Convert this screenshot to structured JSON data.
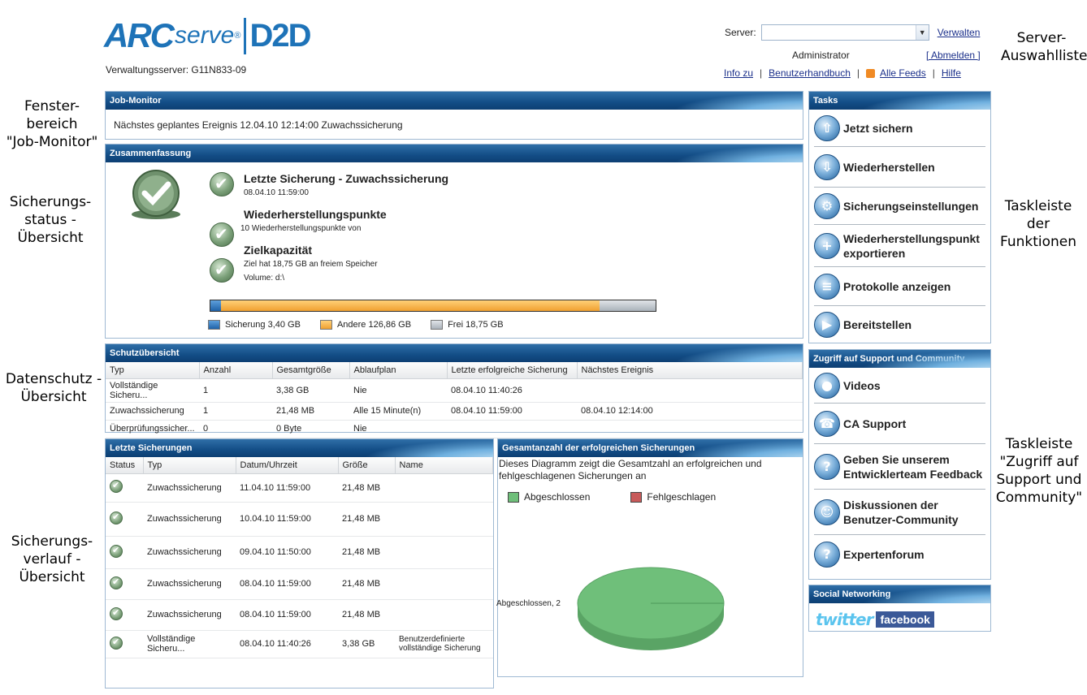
{
  "header": {
    "logo_arc": "ARC",
    "logo_serve": "serve",
    "logo_reg": "®",
    "logo_d2d": "D2D",
    "management_server": "Verwaltungsserver: G11N833-09",
    "server_label": "Server:",
    "server_value": "",
    "manage_link": "Verwalten",
    "user": "Administrator",
    "logout_link": "[ Abmelden ]",
    "links": {
      "info": "Info zu",
      "manual": "Benutzerhandbuch",
      "feeds": "Alle Feeds",
      "help": "Hilfe"
    }
  },
  "annotations": {
    "server_list": "Server-\nAuswahlliste",
    "job_monitor": "Fenster-\nbereich\n\"Job-Monitor\"",
    "backup_status": "Sicherungs-\nstatus -\nÜbersicht",
    "task_bar": "Taskleiste\nder\nFunktionen",
    "data_protection": "Datenschutz -\nÜbersicht",
    "support_bar": "Taskleiste\n\"Zugriff auf\nSupport und\nCommunity\"",
    "backup_history": "Sicherungs-\nverlauf -\nÜbersicht"
  },
  "job_monitor": {
    "title": "Job-Monitor",
    "text": "Nächstes geplantes Ereignis 12.04.10 12:14:00 Zuwachssicherung"
  },
  "summary": {
    "title": "Zusammenfassung",
    "last_backup_title": "Letzte Sicherung - Zuwachssicherung",
    "last_backup_time": "08.04.10 11:59:00",
    "recovery_title": "Wiederherstellungspunkte",
    "recovery_text": "10 Wiederherstellungspunkte von",
    "capacity_title": "Zielkapazität",
    "capacity_free": "Ziel hat 18,75 GB an freiem Speicher",
    "capacity_volume": "Volume: d:\\",
    "usage": {
      "backup_gb": 3.4,
      "other_gb": 126.86,
      "free_gb": 18.75
    },
    "legend": {
      "backup": "Sicherung 3,40 GB",
      "other": "Andere  126,86 GB",
      "free": "Frei  18,75 GB"
    },
    "colors": {
      "backup": "#1f62a8",
      "other": "#f0a030",
      "free": "#aab2ba"
    }
  },
  "protection": {
    "title": "Schutzübersicht",
    "columns": [
      "Typ",
      "Anzahl",
      "Gesamtgröße",
      "Ablaufplan",
      "Letzte erfolgreiche Sicherung",
      "Nächstes Ereignis"
    ],
    "rows": [
      [
        "Vollständige Sicheru...",
        "1",
        "3,38 GB",
        "Nie",
        "08.04.10 11:40:26",
        ""
      ],
      [
        "Zuwachssicherung",
        "1",
        "21,48 MB",
        "Alle 15 Minute(n)",
        "08.04.10 11:59:00",
        "08.04.10 12:14:00"
      ],
      [
        "Überprüfungssicher...",
        "0",
        "0 Byte",
        "Nie",
        "",
        ""
      ]
    ]
  },
  "recent": {
    "title": "Letzte Sicherungen",
    "columns": [
      "Status",
      "Typ",
      "Datum/Uhrzeit",
      "Größe",
      "Name"
    ],
    "rows": [
      [
        "",
        "Zuwachssicherung",
        "11.04.10 11:59:00",
        "21,48 MB",
        ""
      ],
      [
        "",
        "Zuwachssicherung",
        "10.04.10 11:59:00",
        "21,48 MB",
        ""
      ],
      [
        "",
        "Zuwachssicherung",
        "09.04.10 11:50:00",
        "21,48 MB",
        ""
      ],
      [
        "",
        "Zuwachssicherung",
        "08.04.10 11:59:00",
        "21,48 MB",
        ""
      ],
      [
        "",
        "Zuwachssicherung",
        "08.04.10 11:59:00",
        "21,48 MB",
        ""
      ],
      [
        "",
        "Vollständige Sicheru...",
        "08.04.10 11:40:26",
        "3,38 GB",
        "Benutzerdefinierte vollständige Sicherung"
      ]
    ]
  },
  "success_chart": {
    "title": "Gesamtanzahl der erfolgreichen Sicherungen",
    "description": "Dieses Diagramm zeigt die Gesamtzahl an erfolgreichen und fehlgeschlagenen Sicherungen an",
    "legend_ok": "Abgeschlossen",
    "legend_fail": "Fehlgeschlagen",
    "slice_label": "Abgeschlossen, 2",
    "color_ok": "#6fbf7a",
    "color_fail": "#c85a5a"
  },
  "chart_data": {
    "type": "pie",
    "categories": [
      "Abgeschlossen",
      "Fehlgeschlagen"
    ],
    "values": [
      2,
      0
    ],
    "title": "Gesamtanzahl der erfolgreichen Sicherungen"
  },
  "tasks": {
    "title": "Tasks",
    "items": [
      {
        "label": "Jetzt sichern",
        "icon": "backup-now-icon"
      },
      {
        "label": "Wiederherstellen",
        "icon": "restore-icon"
      },
      {
        "label": "Sicherungseinstellungen",
        "icon": "settings-gear-icon"
      },
      {
        "label": "Wiederherstellungspunkt exportieren",
        "icon": "export-icon"
      },
      {
        "label": "Protokolle anzeigen",
        "icon": "log-list-icon"
      },
      {
        "label": "Bereitstellen",
        "icon": "deploy-icon"
      }
    ]
  },
  "support": {
    "title": "Zugriff auf Support und Community",
    "items": [
      {
        "label": "Videos",
        "icon": "video-icon"
      },
      {
        "label": "CA Support",
        "icon": "headset-icon"
      },
      {
        "label": "Geben Sie unserem Entwicklerteam Feedback",
        "icon": "question-icon"
      },
      {
        "label": "Diskussionen der Benutzer-Community",
        "icon": "community-icon"
      },
      {
        "label": "Expertenforum",
        "icon": "question-icon"
      }
    ]
  },
  "social": {
    "title": "Social Networking",
    "twitter": "twitter",
    "facebook": "facebook"
  }
}
